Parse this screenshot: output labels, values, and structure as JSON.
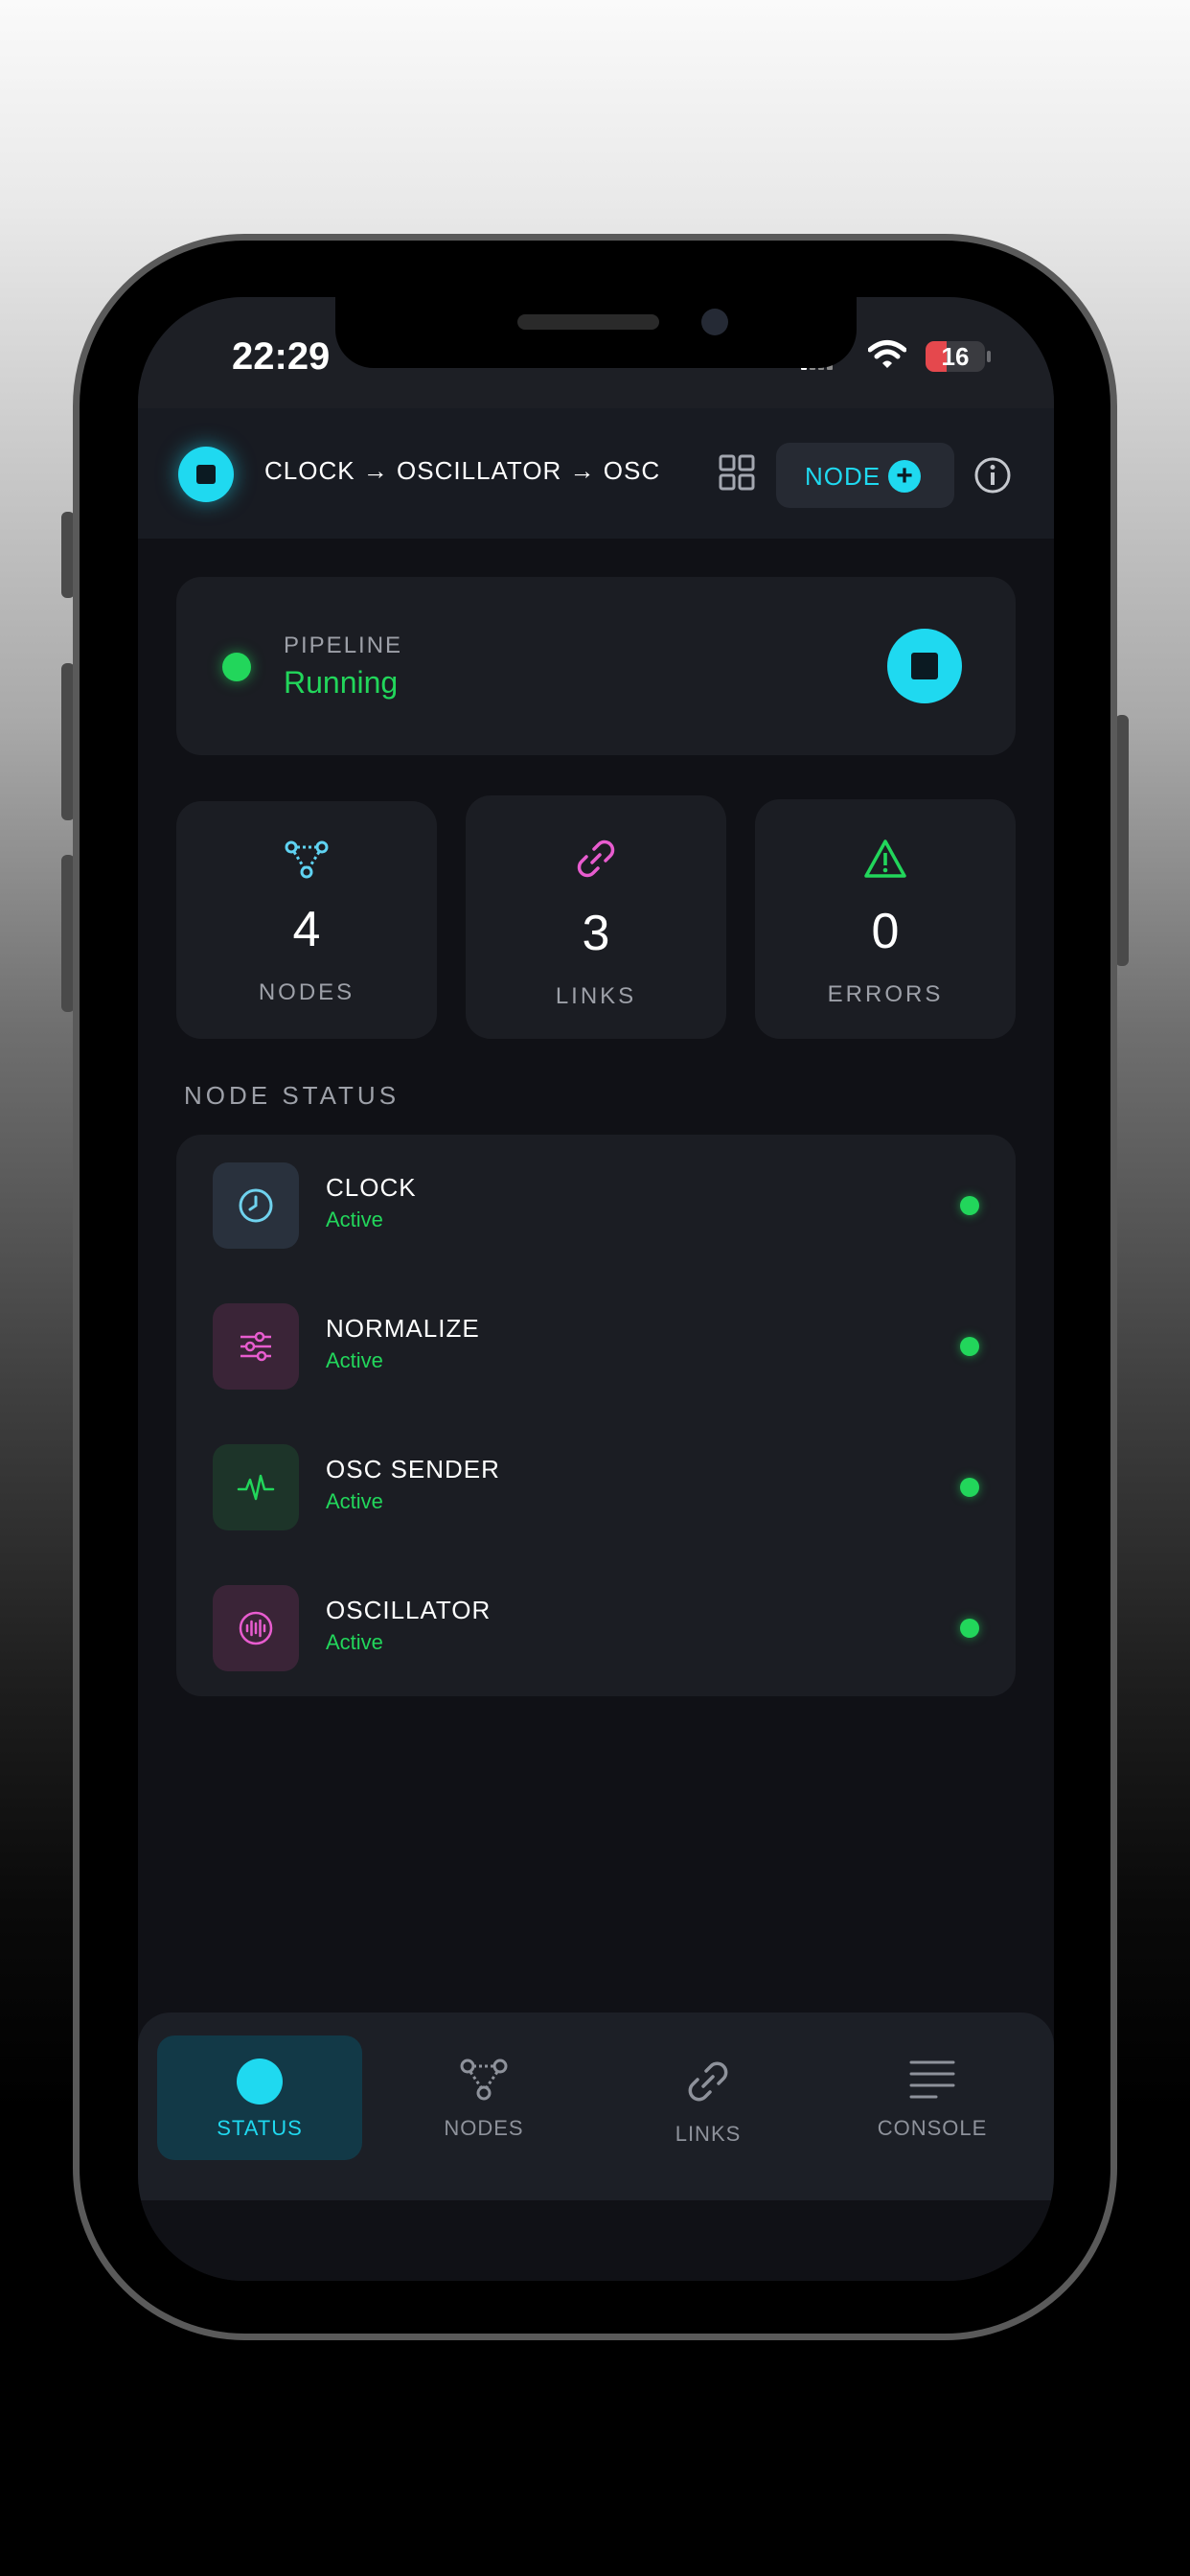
{
  "status_bar": {
    "time": "22:29",
    "battery": "16"
  },
  "header": {
    "pipeline_title": "CLOCK → OSCILLATOR → OSC",
    "node_button_label": "NODE"
  },
  "pipeline": {
    "label": "PIPELINE",
    "status": "Running"
  },
  "stats": [
    {
      "value": "4",
      "label": "NODES",
      "icon": "nodes-icon",
      "color": "#5fd3f2"
    },
    {
      "value": "3",
      "label": "LINKS",
      "icon": "link-icon",
      "color": "#e85ccf"
    },
    {
      "value": "0",
      "label": "ERRORS",
      "icon": "warning-icon",
      "color": "#22d65b"
    }
  ],
  "node_status": {
    "title": "NODE STATUS",
    "items": [
      {
        "name": "CLOCK",
        "state": "Active",
        "icon": "clock-icon"
      },
      {
        "name": "NORMALIZE",
        "state": "Active",
        "icon": "sliders-icon"
      },
      {
        "name": "OSC SENDER",
        "state": "Active",
        "icon": "pulse-icon"
      },
      {
        "name": "OSCILLATOR",
        "state": "Active",
        "icon": "waveform-icon"
      }
    ]
  },
  "tabs": [
    {
      "label": "STATUS",
      "icon": "status-dot-icon",
      "active": true
    },
    {
      "label": "NODES",
      "icon": "nodes-icon",
      "active": false
    },
    {
      "label": "LINKS",
      "icon": "link-icon",
      "active": false
    },
    {
      "label": "CONSOLE",
      "icon": "menu-lines-icon",
      "active": false
    }
  ],
  "colors": {
    "accent": "#1fd9f0",
    "success": "#22d65b",
    "magenta": "#e85ccf"
  }
}
